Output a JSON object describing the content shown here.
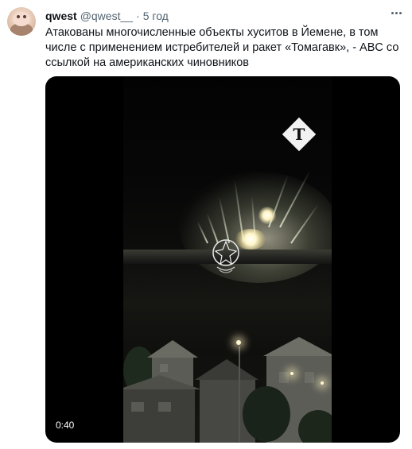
{
  "tweet": {
    "author_name": "qwest",
    "author_handle": "@qwest__",
    "separator": "·",
    "timestamp": "5 год",
    "more_icon": "ellipsis-icon",
    "text": "Атакованы многочисленные объекты хуситов в Йемене, в том числе с применением истребителей и ракет «Томагавк», - ABC со ссылкой на американских чиновников",
    "media": {
      "type": "video",
      "duration": "0:40",
      "logo_letter": "T"
    }
  }
}
